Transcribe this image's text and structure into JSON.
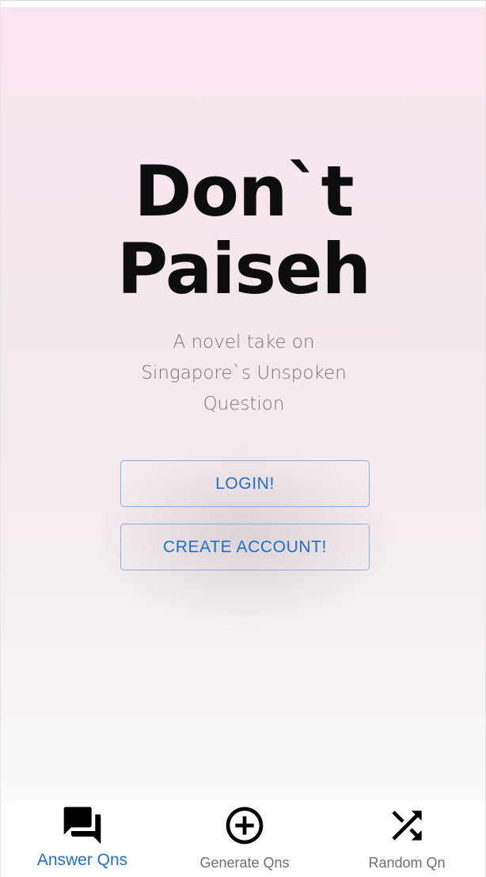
{
  "hero": {
    "title_line1": "Don`t",
    "title_line2": "Paiseh",
    "subtitle": "A novel take on Singapore`s Unspoken Question"
  },
  "actions": {
    "login_label": "LOGIN!",
    "create_account_label": "CREATE ACCOUNT!"
  },
  "bottom_nav": {
    "items": [
      {
        "label": "Answer Qns",
        "icon": "forum-icon",
        "active": true
      },
      {
        "label": "Generate Qns",
        "icon": "add-circle-icon",
        "active": false
      },
      {
        "label": "Random Qn",
        "icon": "shuffle-icon",
        "active": false
      }
    ]
  },
  "colors": {
    "accent": "#1f6fc9",
    "button_border": "#8aaee0",
    "title": "#0d0d0d",
    "subtitle": "#7d7378",
    "nav_inactive": "#6e6e6e",
    "gradient_top": "#fbe5f0",
    "gradient_bottom": "#faf8f9"
  }
}
